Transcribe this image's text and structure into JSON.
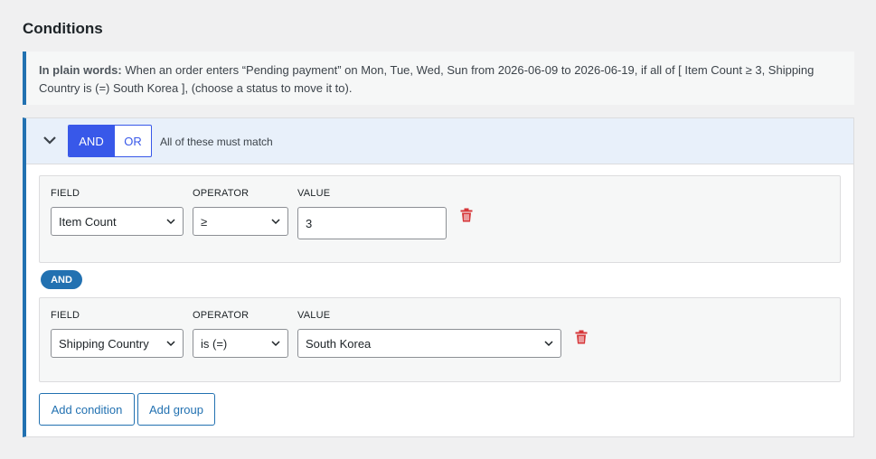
{
  "header": {
    "title": "Conditions"
  },
  "summary": {
    "lead": "In plain words:",
    "text": " When an order enters “Pending payment” on Mon, Tue, Wed, Sun from 2026-06-09 to 2026-06-19, if all of [ Item Count ≥ 3, Shipping Country is (=) South Korea ], (choose a status to move it to)."
  },
  "group": {
    "toggle": {
      "and_label": "AND",
      "or_label": "OR",
      "selected": "AND"
    },
    "match_note": "All of these must match",
    "conditions": [
      {
        "field_label": "FIELD",
        "operator_label": "OPERATOR",
        "value_label": "VALUE",
        "field": "Item Count",
        "operator": "≥",
        "value": "3",
        "value_type": "number",
        "trash_icon": "trash-icon"
      },
      {
        "field_label": "FIELD",
        "operator_label": "OPERATOR",
        "value_label": "VALUE",
        "field": "Shipping Country",
        "operator": "is (=)",
        "value": "South Korea",
        "value_type": "select",
        "trash_icon": "trash-icon"
      }
    ],
    "connector": "AND",
    "buttons": {
      "add_condition": "Add condition",
      "add_group": "Add group"
    }
  },
  "colors": {
    "accent": "#2271b1",
    "toggle_active": "#3858e9",
    "delete": "#d63638",
    "group_header_bg": "#e8f0fa"
  }
}
